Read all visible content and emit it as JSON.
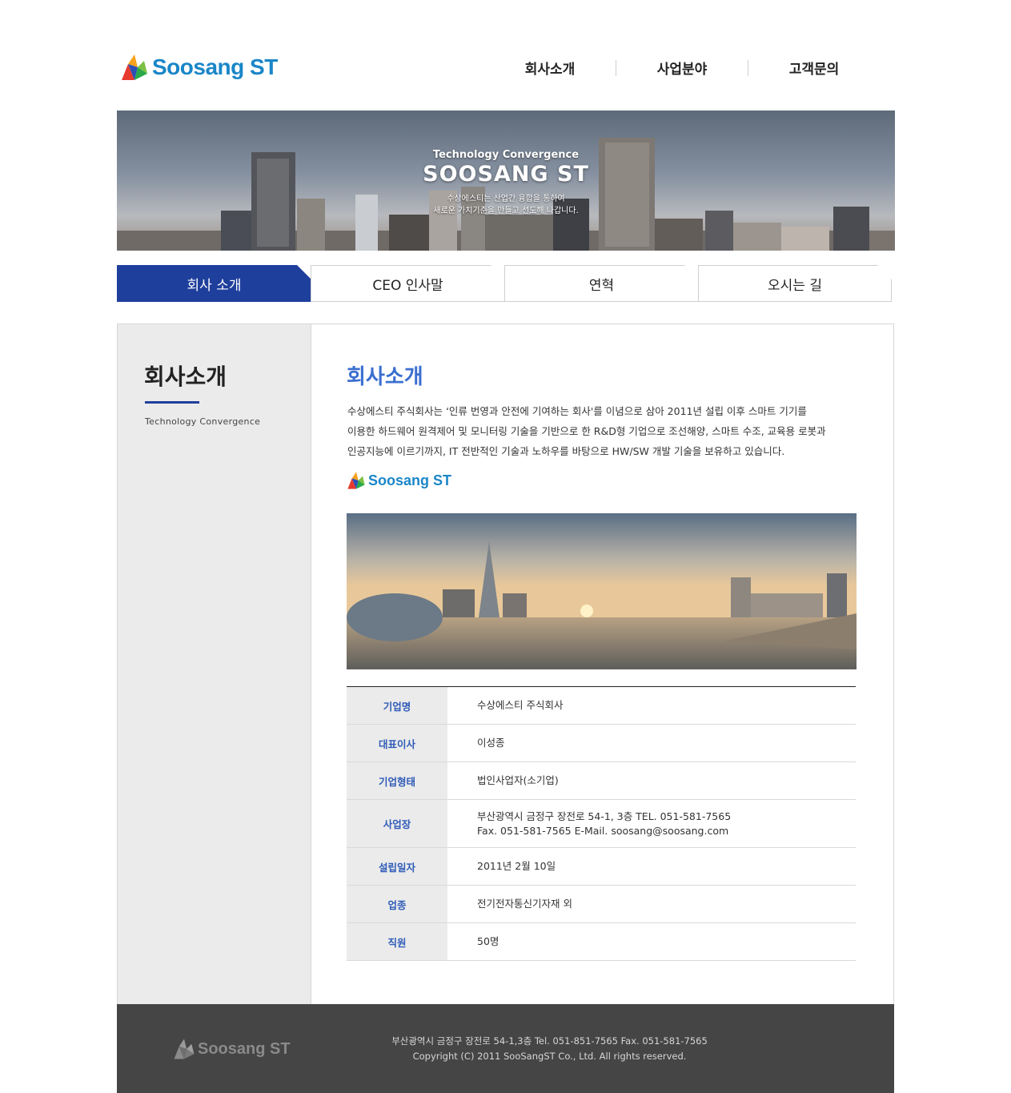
{
  "header": {
    "logo_text": "Soosang ST",
    "nav": [
      "회사소개",
      "사업분야",
      "고객문의"
    ]
  },
  "banner": {
    "subtitle": "Technology Convergence",
    "title": "SOOSANG ST",
    "desc_line1": "수상에스티는 산업간 융합을 통하여",
    "desc_line2": "새로운 가치기준을 만들고 선도해 나갑니다."
  },
  "tabs": [
    "회사 소개",
    "CEO 인사말",
    "연혁",
    "오시는 길"
  ],
  "active_tab": 0,
  "sidebar": {
    "title": "회사소개",
    "subtitle": "Technology Convergence"
  },
  "main": {
    "title": "회사소개",
    "intro_line1": "수상에스티 주식회사는 ‘인류 번영과 안전에 기여하는 회사'를 이념으로 삼아 2011년 설립 이후 스마트 기기를",
    "intro_line2": "이용한 하드웨어 원격제어 및 모니터링 기술을 기반으로 한 R&D형 기업으로 조선해양, 스마트 수조, 교육용 로봇과",
    "intro_line3": "인공지능에 이르기까지, IT 전반적인 기술과 노하우를 바탕으로 HW/SW 개발 기술을 보유하고 있습니다.",
    "logo_text": "Soosang ST"
  },
  "company_info": [
    {
      "label": "기업명",
      "value": "수상에스티 주식회사",
      "value2": ""
    },
    {
      "label": "대표이사",
      "value": "이성종",
      "value2": ""
    },
    {
      "label": "기업형태",
      "value": "법인사업자(소기업)",
      "value2": ""
    },
    {
      "label": "사업장",
      "value": "부산광역시 금정구 장전로 54-1, 3층   TEL. 051-581-7565",
      "value2": "Fax. 051-581-7565   E-Mail. soosang@soosang.com"
    },
    {
      "label": "설립일자",
      "value": "2011년 2월 10일",
      "value2": ""
    },
    {
      "label": "업종",
      "value": "전기전자통신기자재 외",
      "value2": ""
    },
    {
      "label": "직원",
      "value": "50명",
      "value2": ""
    }
  ],
  "footer": {
    "logo_text": "Soosang ST",
    "line1": "부산광역시 금정구 장전로 54-1,3층  Tel. 051-851-7565    Fax. 051-581-7565",
    "line2": "Copyright (C) 2011 SooSangST Co., Ltd. All rights reserved."
  },
  "colors": {
    "brand_blue": "#1a86c8",
    "accent_navy": "#1f3f9c",
    "title_blue": "#3b6fd0",
    "footer_bg": "#454545"
  }
}
